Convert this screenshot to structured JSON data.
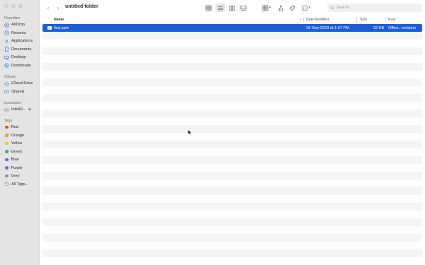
{
  "window": {
    "title": "untitled folder"
  },
  "sidebar": {
    "favorites_title": "Favorites",
    "favorites": [
      {
        "label": "AirDrop",
        "icon": "airdrop-icon"
      },
      {
        "label": "Recents",
        "icon": "clock-icon"
      },
      {
        "label": "Applications",
        "icon": "applications-icon"
      },
      {
        "label": "Documents",
        "icon": "document-icon"
      },
      {
        "label": "Desktop",
        "icon": "desktop-icon"
      },
      {
        "label": "Downloads",
        "icon": "download-icon"
      }
    ],
    "icloud_title": "iCloud",
    "icloud": [
      {
        "label": "iCloud Drive",
        "icon": "cloud-icon"
      },
      {
        "label": "Shared",
        "icon": "shared-folder-icon"
      }
    ],
    "locations_title": "Locations",
    "locations": [
      {
        "label": "IntelliJ...",
        "icon": "disk-icon"
      }
    ],
    "tags_title": "Tags",
    "tags": [
      {
        "label": "Red",
        "color": "#e5453a"
      },
      {
        "label": "Orange",
        "color": "#f29a2e"
      },
      {
        "label": "Yellow",
        "color": "#f4c531"
      },
      {
        "label": "Green",
        "color": "#3fb94b"
      },
      {
        "label": "Blue",
        "color": "#2f7bf0"
      },
      {
        "label": "Purple",
        "color": "#9a5bd0"
      },
      {
        "label": "Grey",
        "color": "#8e8e93"
      }
    ],
    "all_tags": "All Tags..."
  },
  "toolbar": {
    "back_icon": "chevron-left-icon",
    "forward_icon": "chevron-right-icon",
    "search_placeholder": "Search"
  },
  "columns": {
    "name": "Name",
    "date": "Date Modified",
    "size": "Size",
    "kind": "Kind"
  },
  "files": [
    {
      "name": "first.pptx",
      "date": "18-Sep-2023 at 1:07 PM",
      "size": "32 KB",
      "kind": "Office...entation",
      "selected": true
    }
  ],
  "colors": {
    "selection": "#1a5fd6",
    "sidebar_bg": "#e4e4e4",
    "accent": "#2f7bf0"
  }
}
